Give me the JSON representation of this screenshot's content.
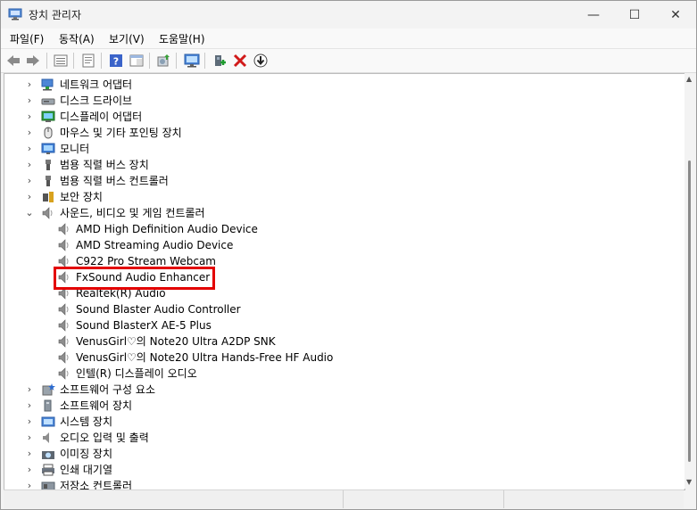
{
  "window": {
    "title": "장치 관리자",
    "minimize_glyph": "—",
    "maximize_glyph": "☐",
    "close_glyph": "✕"
  },
  "menu": [
    {
      "label": "파일(F)"
    },
    {
      "label": "동작(A)"
    },
    {
      "label": "보기(V)"
    },
    {
      "label": "도움말(H)"
    }
  ],
  "toolbar": [
    {
      "name": "back-button",
      "icon": "arrow-left-icon"
    },
    {
      "name": "forward-button",
      "icon": "arrow-right-icon"
    },
    {
      "name": "device-tree-view-button",
      "icon": "list-view-icon"
    },
    {
      "name": "properties-button",
      "icon": "properties-icon"
    },
    {
      "name": "help-button",
      "icon": "help-icon"
    },
    {
      "name": "action-view-button",
      "icon": "panel-icon"
    },
    {
      "name": "update-driver-button",
      "icon": "update-driver-icon"
    },
    {
      "name": "scan-hardware-button",
      "icon": "monitor-scan-icon"
    },
    {
      "name": "enable-device-button",
      "icon": "add-device-icon"
    },
    {
      "name": "uninstall-device-button",
      "icon": "red-x-icon"
    },
    {
      "name": "disable-device-button",
      "icon": "down-arrow-circle-icon"
    }
  ],
  "tree": [
    {
      "label": "네트워크 어댑터",
      "level": 0,
      "expander": "›",
      "icon": "network-adapter-icon"
    },
    {
      "label": "디스크 드라이브",
      "level": 0,
      "expander": "›",
      "icon": "disk-drive-icon"
    },
    {
      "label": "디스플레이 어댑터",
      "level": 0,
      "expander": "›",
      "icon": "display-adapter-icon"
    },
    {
      "label": "마우스 및 기타 포인팅 장치",
      "level": 0,
      "expander": "›",
      "icon": "mouse-icon"
    },
    {
      "label": "모니터",
      "level": 0,
      "expander": "›",
      "icon": "monitor-icon"
    },
    {
      "label": "범용 직렬 버스 장치",
      "level": 0,
      "expander": "›",
      "icon": "usb-icon"
    },
    {
      "label": "범용 직렬 버스 컨트롤러",
      "level": 0,
      "expander": "›",
      "icon": "usb-controller-icon"
    },
    {
      "label": "보안 장치",
      "level": 0,
      "expander": "›",
      "icon": "security-device-icon"
    },
    {
      "label": "사운드, 비디오 및 게임 컨트롤러",
      "level": 0,
      "expander": "⌄",
      "icon": "speaker-icon"
    },
    {
      "label": "AMD High Definition Audio Device",
      "level": 1,
      "expander": "",
      "icon": "speaker-icon"
    },
    {
      "label": "AMD Streaming Audio Device",
      "level": 1,
      "expander": "",
      "icon": "speaker-icon"
    },
    {
      "label": "C922 Pro Stream Webcam",
      "level": 1,
      "expander": "",
      "icon": "speaker-icon"
    },
    {
      "label": "FxSound Audio Enhancer",
      "level": 1,
      "expander": "",
      "icon": "speaker-icon"
    },
    {
      "label": "Realtek(R) Audio",
      "level": 1,
      "expander": "",
      "icon": "speaker-icon"
    },
    {
      "label": "Sound Blaster Audio Controller",
      "level": 1,
      "expander": "",
      "icon": "speaker-icon"
    },
    {
      "label": "Sound BlasterX AE-5 Plus",
      "level": 1,
      "expander": "",
      "icon": "speaker-icon"
    },
    {
      "label": "VenusGirl♡의 Note20 Ultra A2DP SNK",
      "level": 1,
      "expander": "",
      "icon": "speaker-icon"
    },
    {
      "label": "VenusGirl♡의 Note20 Ultra Hands-Free HF Audio",
      "level": 1,
      "expander": "",
      "icon": "speaker-icon"
    },
    {
      "label": "인텔(R) 디스플레이 오디오",
      "level": 1,
      "expander": "",
      "icon": "speaker-icon"
    },
    {
      "label": "소프트웨어 구성 요소",
      "level": 0,
      "expander": "›",
      "icon": "software-component-icon"
    },
    {
      "label": "소프트웨어 장치",
      "level": 0,
      "expander": "›",
      "icon": "software-device-icon"
    },
    {
      "label": "시스템 장치",
      "level": 0,
      "expander": "›",
      "icon": "system-device-icon"
    },
    {
      "label": "오디오 입력 및 출력",
      "level": 0,
      "expander": "›",
      "icon": "audio-io-icon"
    },
    {
      "label": "이미징 장치",
      "level": 0,
      "expander": "›",
      "icon": "camera-icon"
    },
    {
      "label": "인쇄 대기열",
      "level": 0,
      "expander": "›",
      "icon": "printer-icon"
    },
    {
      "label": "저장소 컨트롤러",
      "level": 0,
      "expander": "›",
      "icon": "storage-controller-icon"
    }
  ],
  "highlighted_item": "FxSound Audio Enhancer",
  "colors": {
    "highlight_border": "#e30000",
    "tree_background": "#ffffff",
    "chrome_background": "#f3f3f3"
  }
}
